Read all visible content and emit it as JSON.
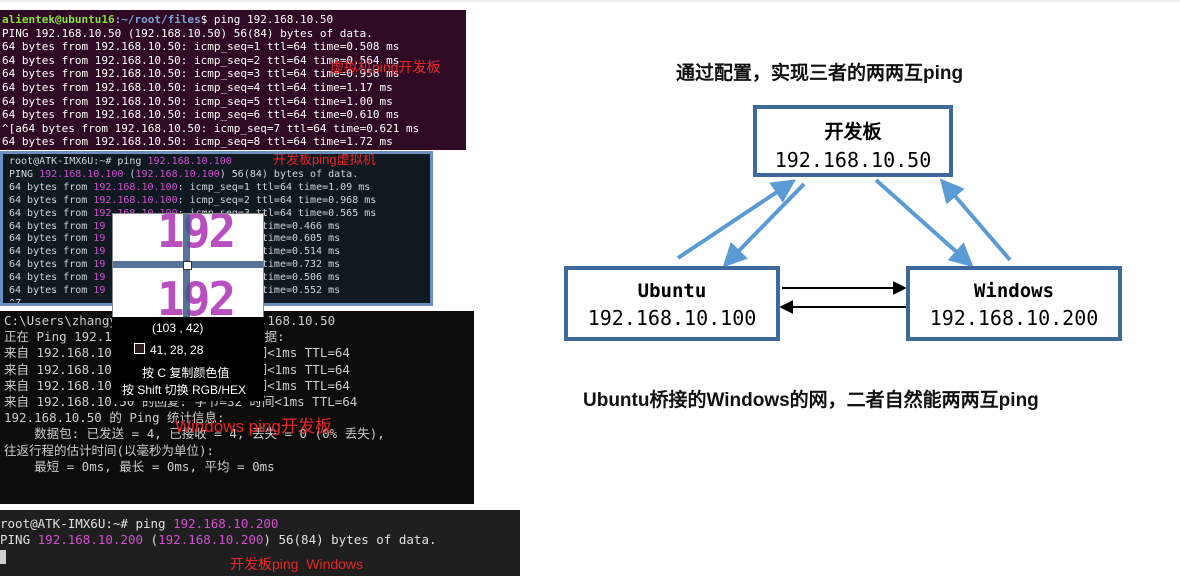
{
  "terminal_vm": {
    "prompt_user": "alientek@ubuntu16",
    "prompt_path": ":~/root/files",
    "prompt_cmd": "$ ping 192.168.10.50",
    "lines": [
      "PING 192.168.10.50 (192.168.10.50) 56(84) bytes of data.",
      "64 bytes from 192.168.10.50: icmp_seq=1 ttl=64 time=0.508 ms",
      "64 bytes from 192.168.10.50: icmp_seq=2 ttl=64 time=0.564 ms",
      "64 bytes from 192.168.10.50: icmp_seq=3 ttl=64 time=0.958 ms",
      "64 bytes from 192.168.10.50: icmp_seq=4 ttl=64 time=1.17 ms",
      "64 bytes from 192.168.10.50: icmp_seq=5 ttl=64 time=1.00 ms",
      "64 bytes from 192.168.10.50: icmp_seq=6 ttl=64 time=0.610 ms",
      "^[a64 bytes from 192.168.10.50: icmp_seq=7 ttl=64 time=0.621 ms",
      "64 bytes from 192.168.10.50: icmp_seq=8 ttl=64 time=1.72 ms"
    ],
    "annotation": "虚拟机ping开发板"
  },
  "terminal_board": {
    "prompt": "root@ATK-IMX6U:~# ping ",
    "target": "192.168.10.100",
    "ping_a": "PING ",
    "ping_b": "192.168.10.100",
    "ping_c": " (",
    "ping_d": "192.168.10.100",
    "ping_e": ") 56(84) bytes of data.",
    "replies": [
      {
        "pre": "64 bytes from ",
        "ip": "192.168.10.100",
        "rest": ": icmp_seq=1 ttl=64 time=1.09 ms"
      },
      {
        "pre": "64 bytes from ",
        "ip": "192.168.10.100",
        "rest": ": icmp_seq=2 ttl=64 time=0.968 ms"
      },
      {
        "pre": "64 bytes from ",
        "ip": "192.168.10.100",
        "rest": ": icmp_seq=3 ttl=64 time=0.565 ms"
      },
      {
        "pre": "64 bytes from ",
        "ip": "19",
        "rest": "                   ttl=64 time=0.466 ms"
      },
      {
        "pre": "64 bytes from ",
        "ip": "19",
        "rest": "                   ttl=64 time=0.605 ms"
      },
      {
        "pre": "64 bytes from ",
        "ip": "19",
        "rest": "                   ttl=64 time=0.514 ms"
      },
      {
        "pre": "64 bytes from ",
        "ip": "19",
        "rest": "                   ttl=64 time=0.732 ms"
      },
      {
        "pre": "64 bytes from ",
        "ip": "19",
        "rest": "                   ttl=64 time=0.506 ms"
      },
      {
        "pre": "64 bytes from ",
        "ip": "19",
        "rest": "                   ttl=64 time=0.552 ms"
      }
    ],
    "last": "^Z",
    "annotation": "开发板ping虚拟机"
  },
  "magnifier": {
    "zoom_text": "192",
    "coords": "(103 , 42)",
    "rgb": "41, 28, 28",
    "hint_copy": "按 C 复制颜色值",
    "hint_switch": "按 Shift 切换 RGB/HEX"
  },
  "terminal_windows": {
    "lines": [
      "C:\\Users\\zhangyong        ping 192.168.10.50",
      "",
      "正在 Ping 192.16       有 32 字节的数据:",
      "来自 192.168.10.5        字节=32 时间<1ms TTL=64",
      "来自 192.168.10.5        字节=32 时间<1ms TTL=64",
      "来自 192.168.10.5        字节=32 时间<1ms TTL=64",
      "来自 192.168.10.50 的回复: 字节=32 时间<1ms TTL=64",
      "",
      "192.168.10.50 的 Ping 统计信息:",
      "    数据包: 已发送 = 4, 已接收 = 4, 丢失 = 0 (0% 丢失),",
      "往返行程的估计时间(以毫秒为单位):",
      "    最短 = 0ms, 最长 = 0ms, 平均 = 0ms"
    ],
    "annotation": "Windows ping开发板"
  },
  "terminal_board2": {
    "prompt": "root@ATK-IMX6U:~# ping ",
    "target": "192.168.10.200",
    "ping_a": "PING ",
    "ping_b": "192.168.10.200",
    "ping_c": " (",
    "ping_d": "192.168.10.200",
    "ping_e": ") 56(84) bytes of data.",
    "annotation": "开发板ping  Windows"
  },
  "diagram": {
    "title": "通过配置，实现三者的两两互ping",
    "board": {
      "name": "开发板",
      "ip": "192.168.10.50"
    },
    "ubuntu": {
      "name": "Ubuntu",
      "ip": "192.168.10.100"
    },
    "windows": {
      "name": "Windows",
      "ip": "192.168.10.200"
    },
    "caption": "Ubuntu桥接的Windows的网，二者自然能两两互ping",
    "colors": {
      "box_border": "#3d6a9a",
      "arrow_light": "#5b9bd5",
      "arrow_dark": "#000000"
    }
  }
}
